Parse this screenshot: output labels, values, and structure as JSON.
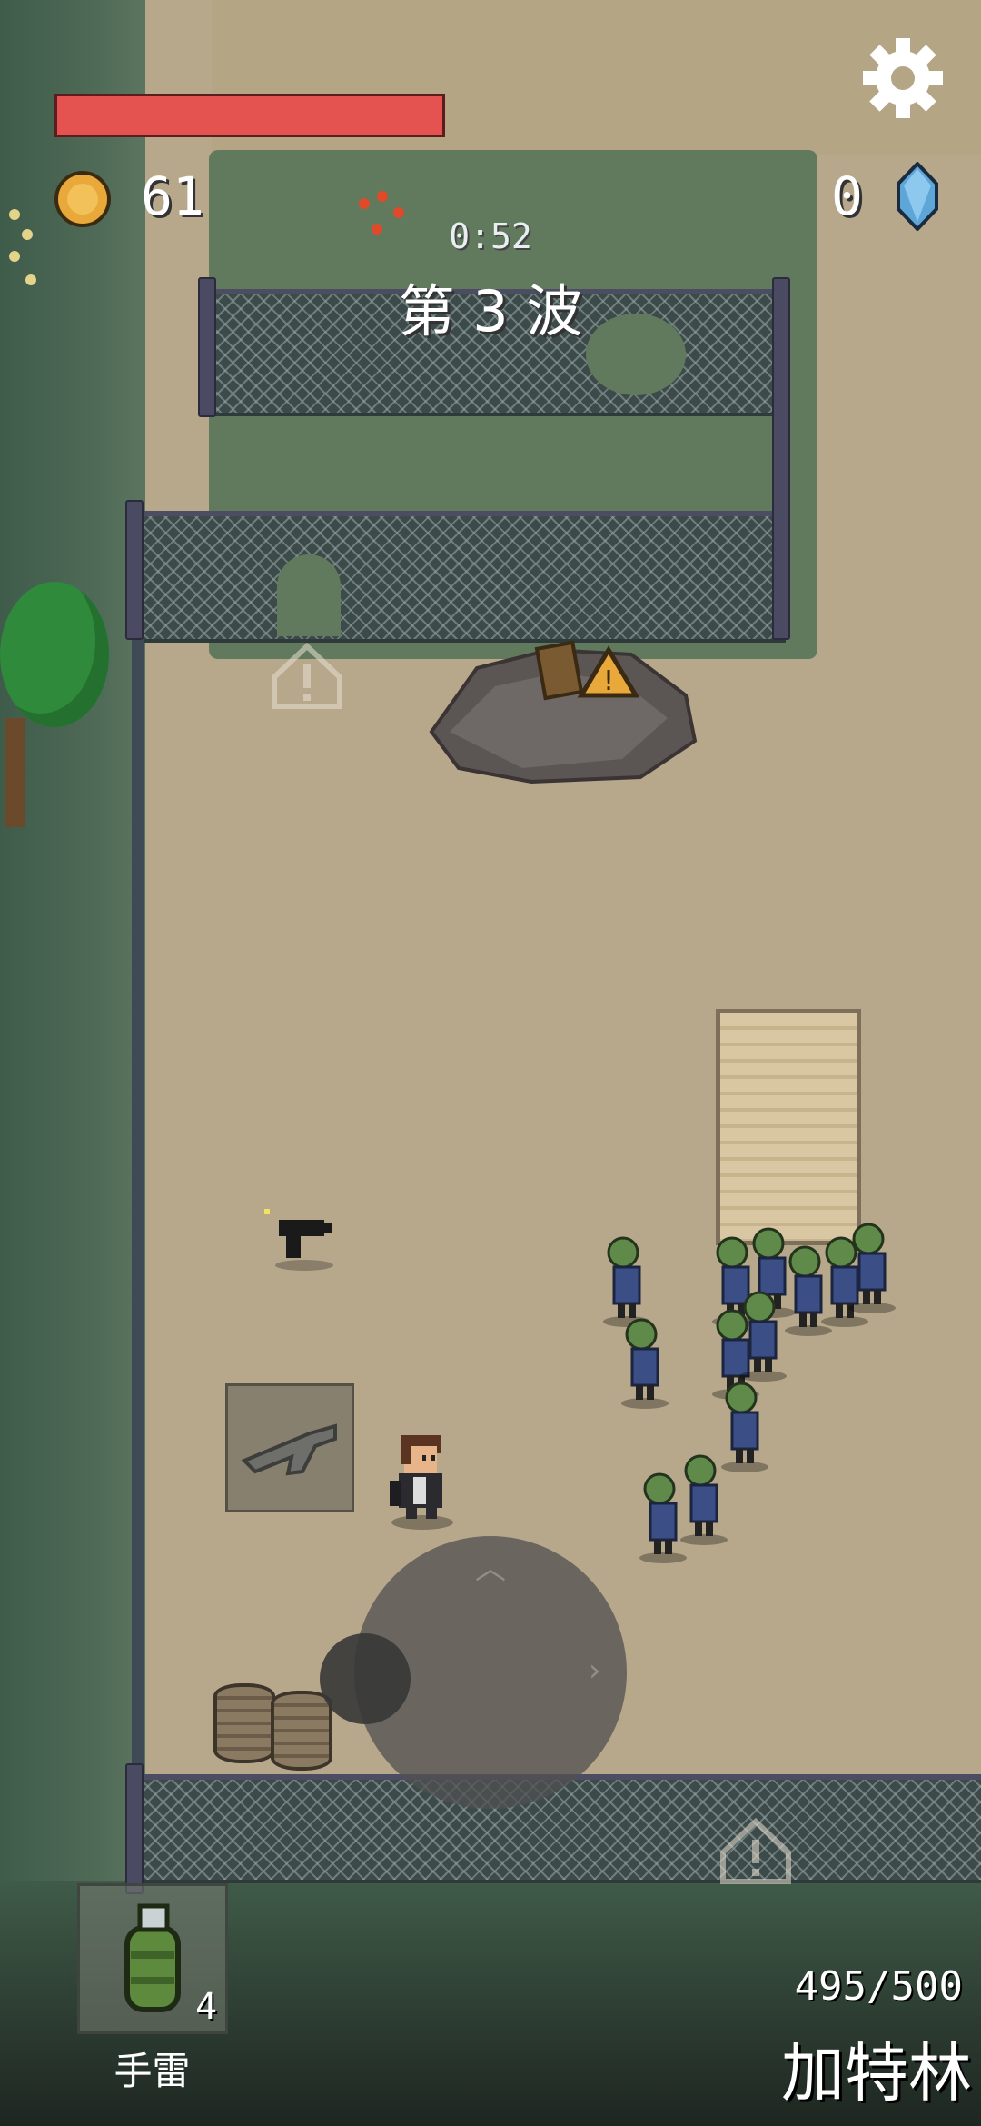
{
  "hud": {
    "health_fraction": 1.0,
    "coins": "61",
    "gems": "0",
    "wave_timer": "0:52",
    "wave_label": "第 3 波"
  },
  "grenade": {
    "count": "4",
    "label": "手雷"
  },
  "weapon": {
    "ammo": "495/500",
    "name": "加特林"
  },
  "colors": {
    "health": "#e55350",
    "coin": "#e8a83a",
    "gem": "#5fa6d8",
    "zombie_skin": "#5f8a4a",
    "zombie_shirt": "#3b4f86"
  },
  "icons": [
    "settings-gear-icon",
    "coin-icon",
    "gem-icon",
    "grenade-icon",
    "shotgun-icon",
    "pistol-pickup-icon",
    "warning-icon"
  ]
}
